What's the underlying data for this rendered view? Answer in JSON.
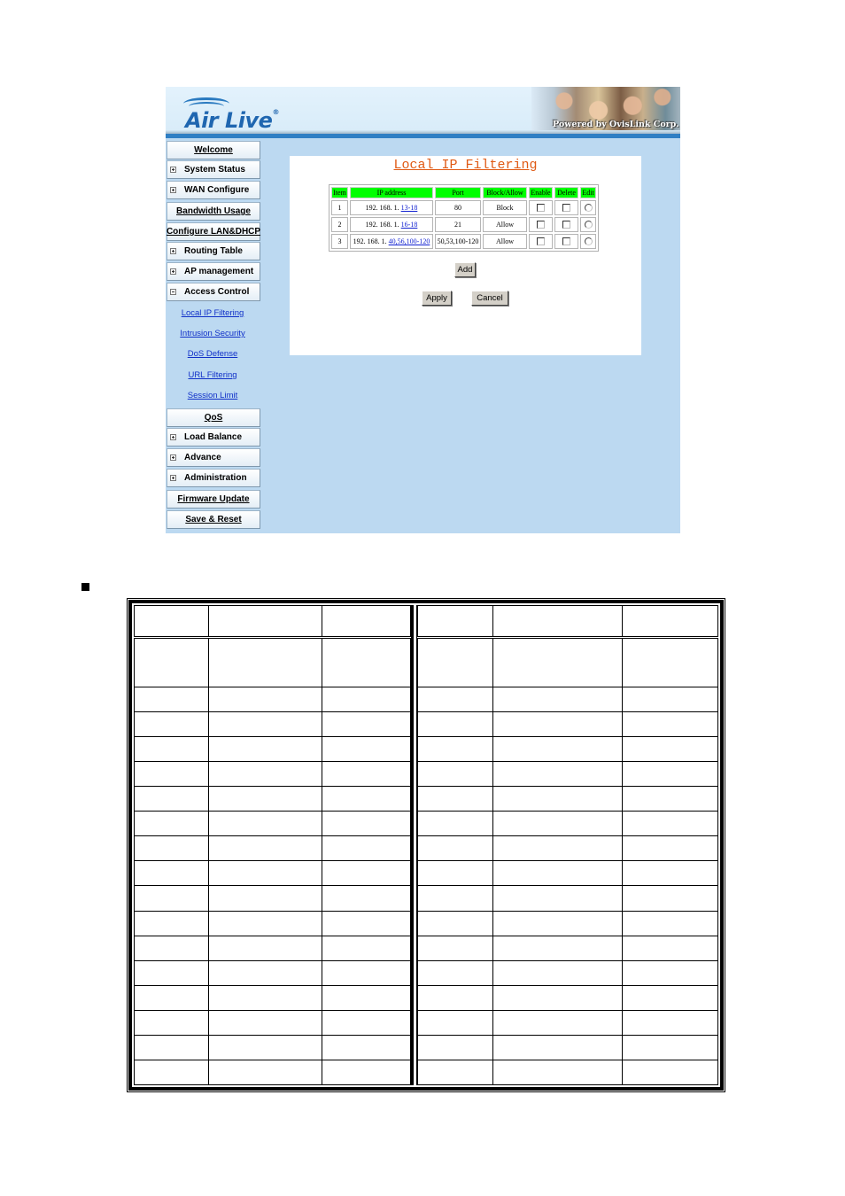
{
  "header": {
    "logo_text": "Air Live",
    "logo_reg": "®",
    "powered_by": "Powered by OvisLink Corp."
  },
  "sidebar": {
    "items": [
      {
        "label": "Welcome",
        "type": "link"
      },
      {
        "label": "System Status",
        "type": "expand",
        "expanded": false
      },
      {
        "label": "WAN Configure",
        "type": "expand",
        "expanded": false
      },
      {
        "label": "Bandwidth Usage",
        "type": "link"
      },
      {
        "label": "Configure LAN&DHCP",
        "type": "link"
      },
      {
        "label": "Routing Table",
        "type": "expand",
        "expanded": false
      },
      {
        "label": "AP management",
        "type": "expand",
        "expanded": false
      },
      {
        "label": "Access Control",
        "type": "expand",
        "expanded": true
      },
      {
        "label": "QoS",
        "type": "link"
      },
      {
        "label": "Load Balance",
        "type": "expand",
        "expanded": false
      },
      {
        "label": "Advance",
        "type": "expand",
        "expanded": false
      },
      {
        "label": "Administration",
        "type": "expand",
        "expanded": false
      },
      {
        "label": "Firmware Update",
        "type": "link"
      },
      {
        "label": "Save & Reset",
        "type": "link"
      }
    ],
    "access_control_subitems": [
      "Local IP Filtering",
      "Intrusion Security",
      "DoS Defense",
      "URL Filtering",
      "Session Limit"
    ]
  },
  "panel": {
    "title": "Local IP Filtering",
    "table": {
      "headers": [
        "Item",
        "IP address",
        "Port",
        "Block/Allow",
        "Enable",
        "Delete",
        "Edit"
      ],
      "rows": [
        {
          "item": "1",
          "ip_prefix": "192. 168. 1. ",
          "ip_range": "13-18",
          "port": "80",
          "action": "Block",
          "enable": false,
          "delete": false,
          "edit": false
        },
        {
          "item": "2",
          "ip_prefix": "192. 168. 1. ",
          "ip_range": "16-18",
          "port": "21",
          "action": "Allow",
          "enable": false,
          "delete": false,
          "edit": false
        },
        {
          "item": "3",
          "ip_prefix": "192. 168. 1. ",
          "ip_range": "40,56,100-120",
          "port": "50,53,100-120",
          "action": "Allow",
          "enable": false,
          "delete": false,
          "edit": false
        }
      ]
    },
    "buttons": {
      "add": "Add",
      "apply": "Apply",
      "cancel": "Cancel"
    }
  },
  "colors": {
    "page_bg": "#bcd9f1",
    "header_blue": "#2f7fc4",
    "title_orange": "#e05a14",
    "table_header_green": "#00ff00",
    "link_blue": "#1030c8"
  },
  "doc_table": {
    "rows": 18,
    "columns_per_half": 3,
    "cells": []
  }
}
